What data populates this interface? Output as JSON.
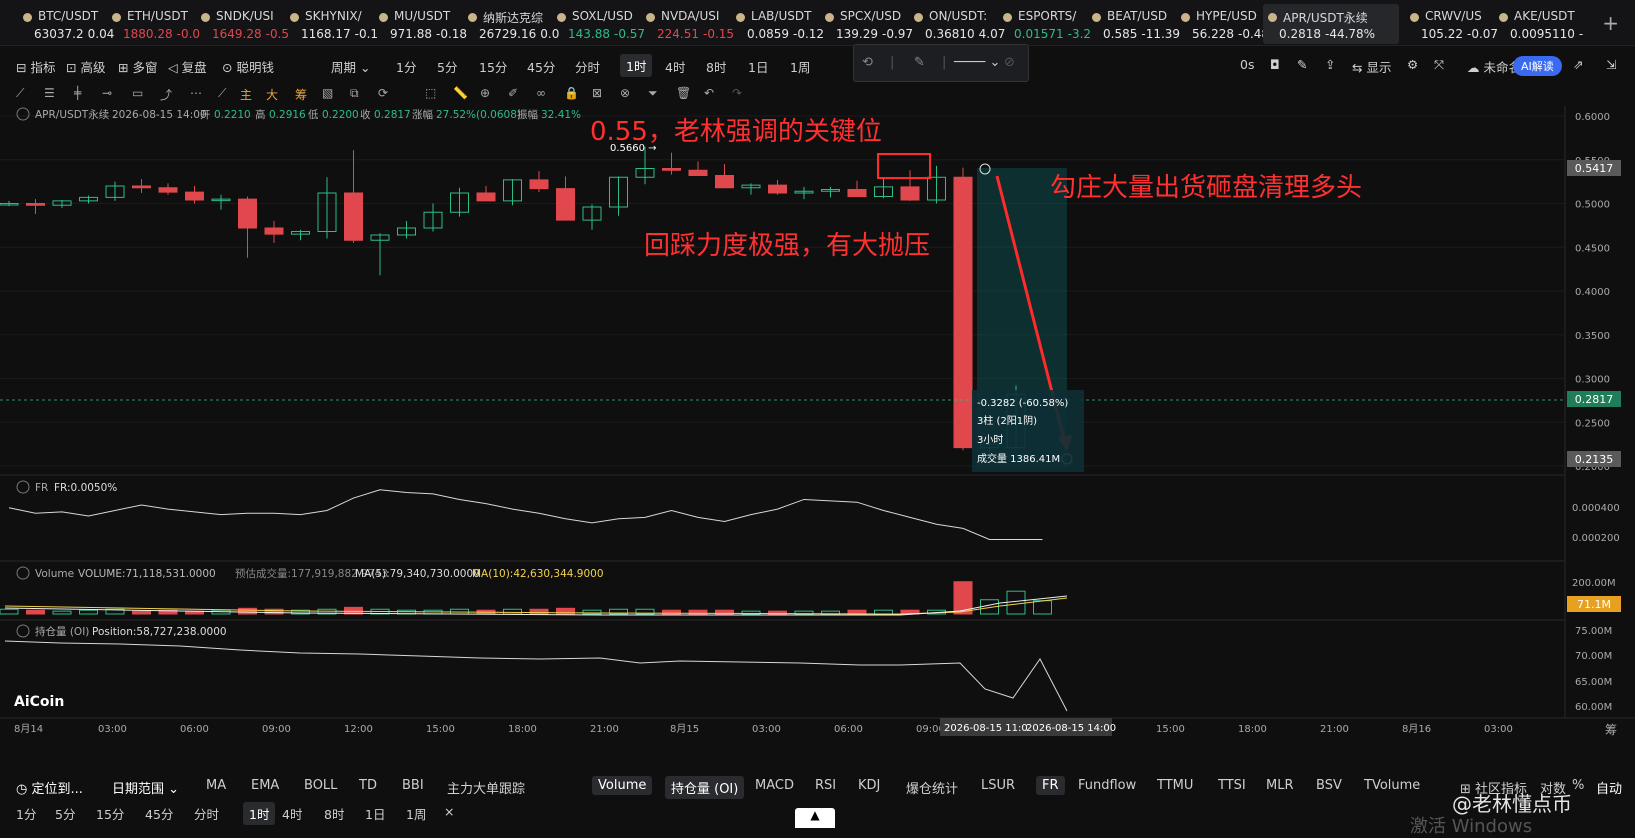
{
  "tickers": [
    {
      "name": "BTC/USDT",
      "price": "63037.2",
      "chg": "0.04",
      "dir": "wt"
    },
    {
      "name": "ETH/USDT",
      "price": "1880.28",
      "chg": "-0.0",
      "dir": "dn"
    },
    {
      "name": "SNDK/USI",
      "price": "1649.28",
      "chg": "-0.5",
      "dir": "dn"
    },
    {
      "name": "SKHYNIX/",
      "price": "1168.17",
      "chg": "-0.1",
      "dir": "wt"
    },
    {
      "name": "MU/USDT",
      "price": "971.88",
      "chg": "-0.18",
      "dir": "wt"
    },
    {
      "name": "纳斯达克综",
      "price": "26729.16",
      "chg": "0.0",
      "dir": "wt"
    },
    {
      "name": "SOXL/USD",
      "price": "143.88",
      "chg": "-0.57",
      "dir": "up"
    },
    {
      "name": "NVDA/USI",
      "price": "224.51",
      "chg": "-0.15",
      "dir": "dn"
    },
    {
      "name": "LAB/USDT",
      "price": "0.0859",
      "chg": "-0.12",
      "dir": "wt"
    },
    {
      "name": "SPCX/USD",
      "price": "139.29",
      "chg": "-0.97",
      "dir": "wt"
    },
    {
      "name": "ON/USDT:",
      "price": "0.36810",
      "chg": "4.07",
      "dir": "wt"
    },
    {
      "name": "ESPORTS/",
      "price": "0.01571",
      "chg": "-3.2",
      "dir": "up"
    },
    {
      "name": "BEAT/USD",
      "price": "0.585",
      "chg": "-11.39",
      "dir": "wt"
    },
    {
      "name": "HYPE/USD",
      "price": "56.228",
      "chg": "-0.48",
      "dir": "wt"
    },
    {
      "name": "APR/USDT永续",
      "price": "0.2818",
      "chg": "-44.78%",
      "dir": "wt"
    },
    {
      "name": "CRWV/US",
      "price": "105.22",
      "chg": "-0.07",
      "dir": "wt"
    },
    {
      "name": "AKE/USDT",
      "price": "0.0095110",
      "chg": "-",
      "dir": "wt"
    }
  ],
  "toolbar": {
    "indicator": "指标",
    "advanced": "高级",
    "multi": "多窗",
    "replay": "复盘",
    "smart": "聪明钱",
    "period": "周期",
    "periods": [
      "1分",
      "5分",
      "15分",
      "45分",
      "分时",
      "1时",
      "4时",
      "8时",
      "1日",
      "1周"
    ],
    "active_period": "1时",
    "right": {
      "countdown": "0s",
      "display": "显示",
      "unnamed": "未命名",
      "ai": "AI解读"
    }
  },
  "drawbar": {
    "items": [
      "主",
      "大",
      "筹"
    ]
  },
  "header": {
    "symbol": "APR/USDT永续",
    "date": "2026-08-15 14:00",
    "open_l": "开",
    "open": "0.2210",
    "high_l": "高",
    "high": "0.2916",
    "low_l": "低",
    "low": "0.2200",
    "close_l": "收",
    "close": "0.2817",
    "chg_l": "涨幅",
    "chg": "27.52%(0.0608)",
    "amp_l": "振幅",
    "amp": "32.41%"
  },
  "annotations": {
    "key_level": "0.55，老林强调的关键位",
    "pullback": "回踩力度极强，有大抛压",
    "dump": "勾庄大量出货砸盘清理多头",
    "peak": "0.5660 →"
  },
  "measure": {
    "line1": "-0.3282 (-60.58%)",
    "line2": "3柱 (2阳1阴)",
    "line3": "3小时",
    "line4": "成交量 1386.41M"
  },
  "chart_data": {
    "type": "candlestick",
    "symbol": "APR/USDT永续",
    "y_ticks": [
      "0.6000",
      "0.5500",
      "0.5000",
      "0.4500",
      "0.4000",
      "0.3500",
      "0.3000",
      "0.2500",
      "0.2000"
    ],
    "price_tags": {
      "top": "0.5417",
      "current": "0.2817",
      "bottom": "0.2135"
    },
    "x_ticks": [
      "8月14",
      "03:00",
      "06:00",
      "09:00",
      "12:00",
      "15:00",
      "18:00",
      "21:00",
      "8月15",
      "03:00",
      "06:00",
      "09:00",
      "15:00",
      "18:00",
      "21:00",
      "8月16",
      "03:00",
      "06:00"
    ],
    "x_highlight": [
      "2026-08-15 11:0",
      "2026-08-15 14:00"
    ],
    "candles": [
      [
        0.499,
        0.503,
        0.497,
        0.5
      ],
      [
        0.5,
        0.505,
        0.488,
        0.498
      ],
      [
        0.498,
        0.504,
        0.495,
        0.503
      ],
      [
        0.503,
        0.509,
        0.5,
        0.507
      ],
      [
        0.507,
        0.525,
        0.503,
        0.52
      ],
      [
        0.52,
        0.528,
        0.512,
        0.518
      ],
      [
        0.518,
        0.523,
        0.51,
        0.513
      ],
      [
        0.513,
        0.52,
        0.5,
        0.504
      ],
      [
        0.504,
        0.51,
        0.493,
        0.505
      ],
      [
        0.505,
        0.508,
        0.438,
        0.472
      ],
      [
        0.472,
        0.48,
        0.455,
        0.465
      ],
      [
        0.465,
        0.47,
        0.458,
        0.468
      ],
      [
        0.468,
        0.53,
        0.46,
        0.512
      ],
      [
        0.512,
        0.561,
        0.455,
        0.458
      ],
      [
        0.458,
        0.466,
        0.418,
        0.464
      ],
      [
        0.464,
        0.48,
        0.46,
        0.472
      ],
      [
        0.472,
        0.5,
        0.468,
        0.49
      ],
      [
        0.49,
        0.518,
        0.485,
        0.512
      ],
      [
        0.512,
        0.52,
        0.503,
        0.503
      ],
      [
        0.503,
        0.528,
        0.498,
        0.527
      ],
      [
        0.527,
        0.537,
        0.513,
        0.517
      ],
      [
        0.517,
        0.531,
        0.482,
        0.481
      ],
      [
        0.481,
        0.499,
        0.47,
        0.496
      ],
      [
        0.496,
        0.531,
        0.486,
        0.53
      ],
      [
        0.53,
        0.565,
        0.522,
        0.54
      ],
      [
        0.54,
        0.558,
        0.533,
        0.538
      ],
      [
        0.538,
        0.548,
        0.532,
        0.532
      ],
      [
        0.532,
        0.545,
        0.518,
        0.518
      ],
      [
        0.518,
        0.523,
        0.51,
        0.521
      ],
      [
        0.521,
        0.527,
        0.51,
        0.512
      ],
      [
        0.512,
        0.519,
        0.505,
        0.514
      ],
      [
        0.514,
        0.519,
        0.507,
        0.516
      ],
      [
        0.516,
        0.526,
        0.508,
        0.508
      ],
      [
        0.508,
        0.528,
        0.506,
        0.519
      ],
      [
        0.519,
        0.538,
        0.503,
        0.504
      ],
      [
        0.504,
        0.543,
        0.5,
        0.53
      ],
      [
        0.53,
        0.541,
        0.218,
        0.221
      ],
      [
        0.221,
        0.228,
        0.212,
        0.225
      ],
      [
        0.221,
        0.292,
        0.22,
        0.282
      ]
    ],
    "fr": {
      "label": "FR",
      "value": "FR:0.0050%",
      "ticks": [
        "0.000400",
        "0.000200"
      ]
    },
    "volume": {
      "label": "Volume",
      "value": "VOLUME:71,118,531.0000",
      "est": "预估成交量:177,919,882.9743",
      "ma5": "MA(5):79,340,730.0000",
      "ma10": "MA(10):42,630,344.9000",
      "tick": "200.00M",
      "tag": "71.1M"
    },
    "oi": {
      "label": "持仓量 (OI)",
      "value": "Position:58,727,238.0000",
      "ticks": [
        "75.00M",
        "70.00M",
        "65.00M",
        "60.00M"
      ]
    }
  },
  "bottom": {
    "locate": "定位到...",
    "range": "日期范围",
    "indicators": [
      "MA",
      "EMA",
      "BOLL",
      "TD",
      "BBI",
      "主力大单跟踪",
      "Volume",
      "持仓量 (OI)",
      "MACD",
      "RSI",
      "KDJ",
      "爆仓统计",
      "LSUR",
      "FR",
      "Fundflow",
      "TTMU",
      "TTSI",
      "MLR",
      "BSV",
      "TVolume"
    ],
    "community": "社区指标",
    "log": "对数",
    "pct": "%",
    "auto": "自动",
    "periods": [
      "1分",
      "5分",
      "15分",
      "45分",
      "分时",
      "1时",
      "4时",
      "8时",
      "1日",
      "1周"
    ],
    "active_period": "1时"
  },
  "watermark": {
    "brand": "AiCoin",
    "author": "@老林懂点币",
    "win": "激活 Windows"
  }
}
